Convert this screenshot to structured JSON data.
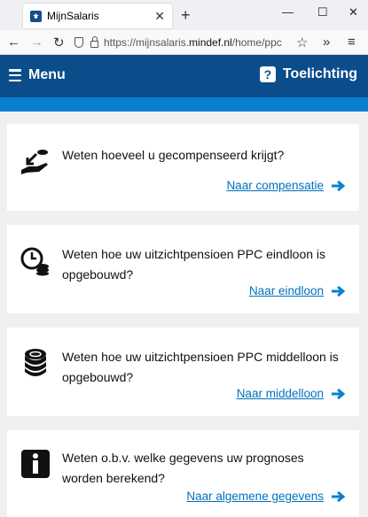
{
  "browser": {
    "tab_title": "MijnSalaris",
    "url_prefix": "https://mijnsalaris.",
    "url_host": "mindef.nl",
    "url_path": "/home/ppc"
  },
  "header": {
    "menu_label": "Menu",
    "help_label": "Toelichting"
  },
  "cards": [
    {
      "text": "Weten hoeveel u gecompenseerd krijgt?",
      "link": "Naar compensatie",
      "icon": "hand-coin-icon"
    },
    {
      "text": "Weten hoe uw uitzichtpensioen PPC eindloon is opgebouwd?",
      "link": "Naar eindloon",
      "icon": "clock-coins-icon"
    },
    {
      "text": "Weten hoe uw uitzichtpensioen PPC middelloon is opgebouwd?",
      "link": "Naar middelloon",
      "icon": "coin-stack-icon"
    },
    {
      "text": "Weten o.b.v. welke gegevens uw prognoses worden berekend?",
      "link": "Naar algemene gegevens",
      "icon": "info-icon"
    }
  ],
  "colors": {
    "header_bg": "#0b4d8a",
    "strip": "#0a7fd1",
    "link": "#0070c0"
  }
}
